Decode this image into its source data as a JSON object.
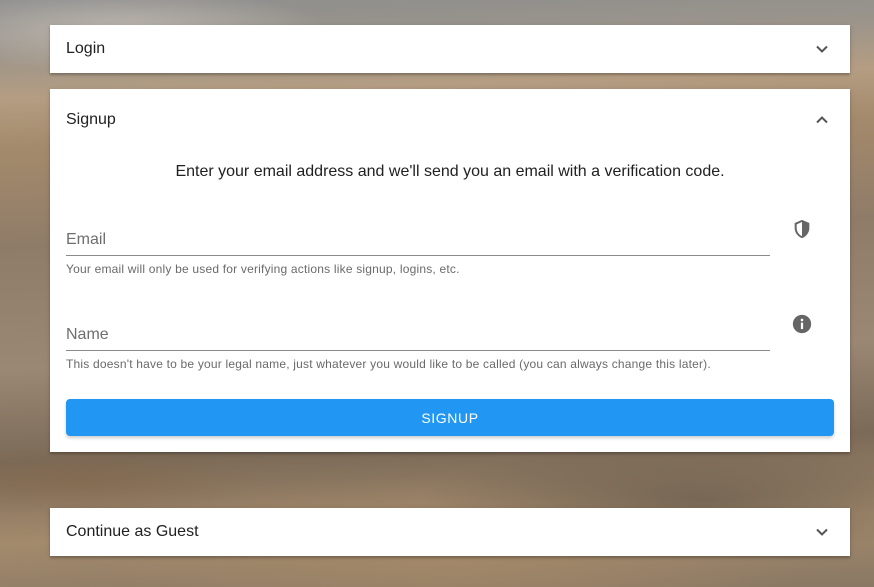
{
  "login": {
    "title": "Login",
    "icon": "chevron-down-icon"
  },
  "signup": {
    "title": "Signup",
    "icon": "chevron-up-icon",
    "intro": "Enter your email address and we'll send you an email with a verification code.",
    "email": {
      "placeholder": "Email",
      "value": "",
      "hint": "Your email will only be used for verifying actions like signup, logins, etc.",
      "icon": "shield-icon"
    },
    "name": {
      "placeholder": "Name",
      "value": "",
      "hint": "This doesn't have to be your legal name, just whatever you would like to be called (you can always change this later).",
      "icon": "info-icon"
    },
    "button_label": "Signup",
    "button_color": "#2196f3"
  },
  "guest": {
    "title": "Continue as Guest",
    "icon": "chevron-down-icon"
  }
}
